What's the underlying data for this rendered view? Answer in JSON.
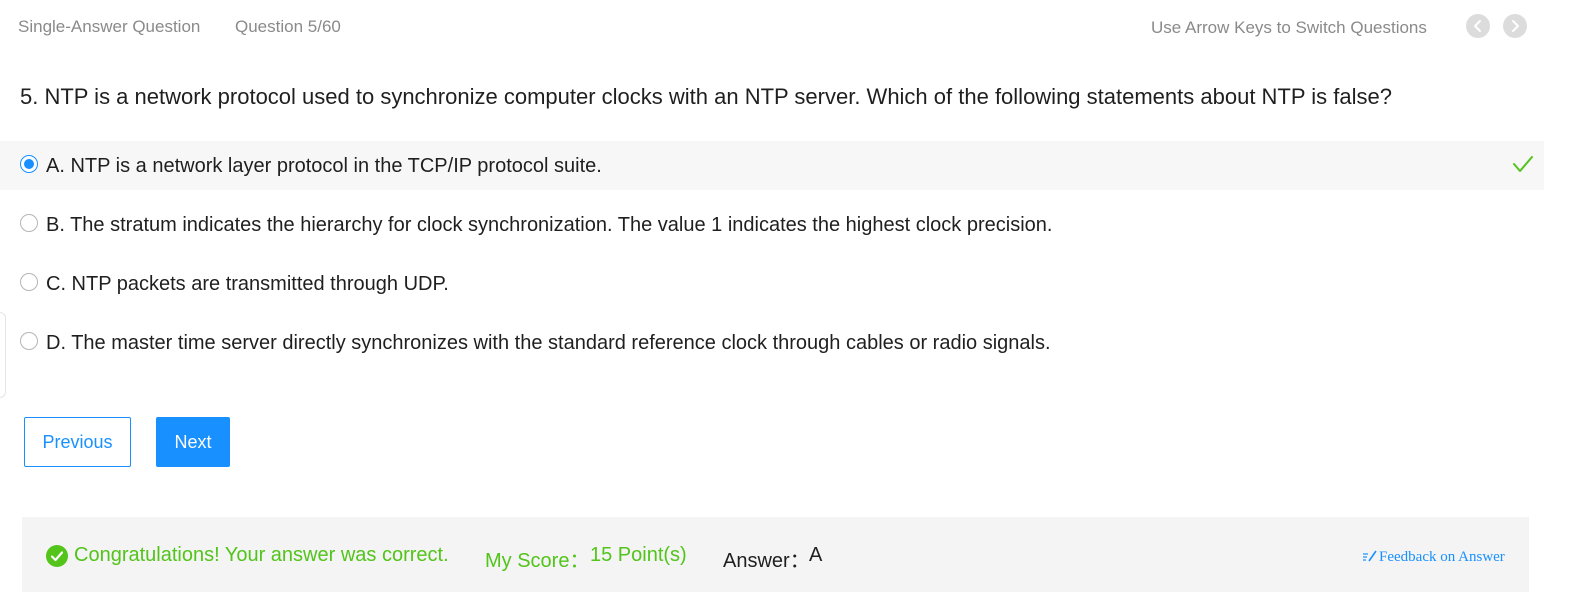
{
  "header": {
    "question_type": "Single-Answer Question",
    "question_index": "Question 5/60",
    "hint": "Use Arrow Keys to Switch Questions"
  },
  "question": {
    "text": "5. NTP is a network protocol used to synchronize computer clocks with an NTP server. Which of the following statements about NTP is false?",
    "options": [
      {
        "label": "A. NTP is a network layer protocol in the TCP/IP protocol suite.",
        "selected": true,
        "marked_correct": true
      },
      {
        "label": "B. The stratum indicates the hierarchy for clock synchronization. The value 1 indicates the highest clock precision.",
        "selected": false
      },
      {
        "label": "C. NTP packets are transmitted through UDP.",
        "selected": false
      },
      {
        "label": "D. The master time server directly synchronizes with the standard reference clock through cables or radio signals.",
        "selected": false
      }
    ]
  },
  "buttons": {
    "previous": "Previous",
    "next": "Next"
  },
  "result": {
    "message": "Congratulations! Your answer was correct.",
    "score_label": "My Score：",
    "score_value": "15 Point(s)",
    "answer_label": "Answer：",
    "answer_value": "A",
    "feedback_link": "Feedback on Answer"
  },
  "icons": {
    "prev": "chevron-left-icon",
    "next": "chevron-right-icon",
    "correct": "checkmark-icon",
    "success": "check-circle-icon",
    "feedback": "edit-note-icon"
  },
  "colors": {
    "accent": "#1890ff",
    "success": "#52c41a",
    "muted_text": "#8a8a8a",
    "panel_bg": "#f4f4f4"
  }
}
